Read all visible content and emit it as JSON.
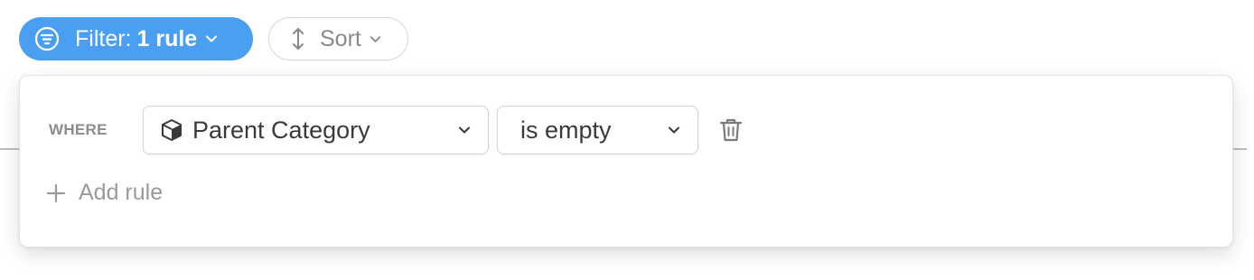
{
  "toolbar": {
    "filter": {
      "label": "Filter:",
      "count": "1 rule",
      "icon": "filter-icon",
      "color": "#4a9ff2"
    },
    "sort": {
      "label": "Sort",
      "icon": "sort-arrows-icon"
    }
  },
  "filter_popover": {
    "where_label": "WHERE",
    "rule": {
      "field": {
        "value": "Parent Category",
        "icon": "cube-icon"
      },
      "operator": {
        "value": "is empty"
      }
    },
    "add_rule_label": "Add rule"
  }
}
